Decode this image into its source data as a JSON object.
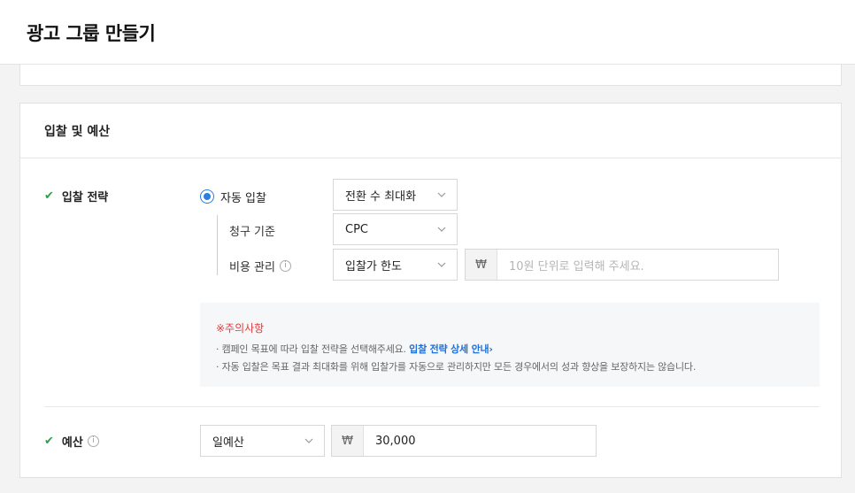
{
  "page": {
    "title": "광고 그룹 만들기"
  },
  "bidding_section": {
    "title": "입찰 및 예산",
    "bid_strategy": {
      "label": "입찰 전략",
      "radio_label": "자동 입찰",
      "strategy_value": "전환 수 최대화",
      "billing_label": "청구 기준",
      "billing_value": "CPC",
      "cost_label": "비용 관리",
      "cost_value": "입찰가 한도",
      "currency_symbol": "₩",
      "amount_placeholder": "10원 단위로 입력해 주세요."
    },
    "notice": {
      "title": "※주의사항",
      "line1_text": "· 캠페인 목표에 따라 입찰 전략을 선택해주세요.",
      "line1_link": "입찰 전략 상세 안내",
      "line1_arrow": "›",
      "line2_text": "· 자동 입찰은 목표 결과 최대화를 위해 입찰가를 자동으로 관리하지만 모든 경우에서의 성과 향상을 보장하지는 않습니다."
    },
    "budget": {
      "label": "예산",
      "type_value": "일예산",
      "currency_symbol": "₩",
      "amount_value": "30,000"
    }
  },
  "icons": {
    "info": "i",
    "check": "✔"
  },
  "colors": {
    "accent": "#2a7de1",
    "check": "#2e9e46",
    "warning": "#e33c3c",
    "link": "#1f6fd8"
  }
}
